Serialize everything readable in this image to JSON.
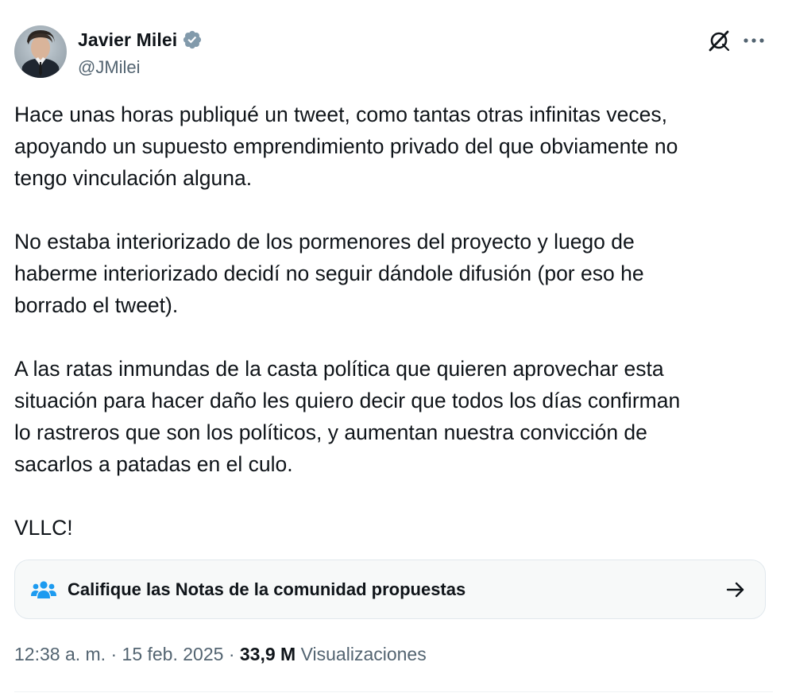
{
  "author": {
    "display_name": "Javier Milei",
    "handle": "@JMilei",
    "verified_icon": "verified-badge-icon"
  },
  "actions": {
    "grok_icon": "grok-icon",
    "more_icon": "more-options-icon"
  },
  "body": {
    "paragraphs": [
      "Hace unas horas publiqué un tweet, como tantas otras infinitas veces,\napoyando un supuesto emprendimiento privado del que obviamente no\ntengo vinculación alguna.",
      "No estaba interiorizado de los pormenores del proyecto y luego de\nhaberme interiorizado decidí no seguir dándole difusión (por eso he\nborrado el tweet).",
      "A las ratas inmundas de la casta política que quieren aprovechar esta\nsituación para hacer daño les quiero decir que todos los días confirman\nlo rastreros que son los políticos, y aumentan nuestra convicción de\nsacarlos a patadas en el culo.",
      "VLLC!"
    ]
  },
  "community_notes": {
    "label": "Califique las Notas de la comunidad propuestas",
    "icon": "community-icon",
    "arrow_icon": "arrow-right-icon"
  },
  "meta": {
    "time": "12:38 a. m.",
    "separator": "·",
    "date": "15 feb. 2025",
    "views_count": "33,9 M",
    "views_label": "Visualizaciones"
  },
  "colors": {
    "text": "#0f1419",
    "secondary": "#536471",
    "verified": "#829aab",
    "community_icon": "#1d9bf0",
    "card_bg": "#f7f9f9"
  }
}
